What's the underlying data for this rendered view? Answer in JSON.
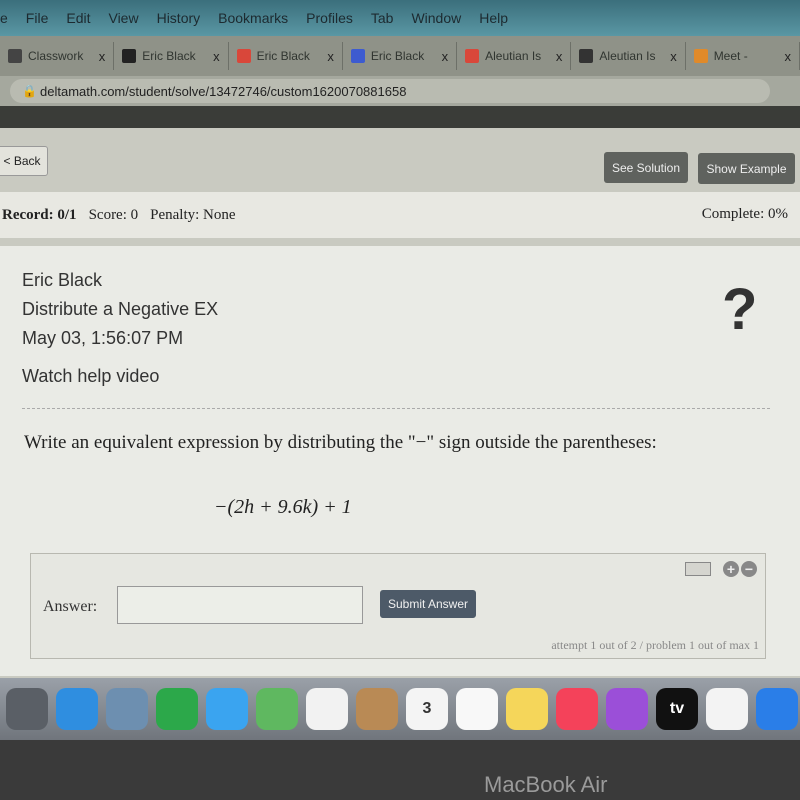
{
  "menubar": [
    "e",
    "File",
    "Edit",
    "View",
    "History",
    "Bookmarks",
    "Profiles",
    "Tab",
    "Window",
    "Help"
  ],
  "tabs": [
    {
      "label": "Classwork",
      "color": "#444"
    },
    {
      "label": "Eric Black",
      "color": "#222"
    },
    {
      "label": "Eric Black",
      "color": "#d9473a"
    },
    {
      "label": "Eric Black",
      "color": "#3d5bd0"
    },
    {
      "label": "Aleutian Is",
      "color": "#d9473a"
    },
    {
      "label": "Aleutian Is",
      "color": "#333"
    },
    {
      "label": "Meet -",
      "color": "#e08a2a"
    }
  ],
  "tab_close": "x",
  "url": "deltamath.com/student/solve/13472746/custom1620070881658",
  "toolbar": {
    "back": "< Back",
    "see_solution": "See Solution",
    "show_example": "Show Example"
  },
  "record": {
    "record": "Record: 0/1",
    "score": "Score: 0",
    "penalty": "Penalty: None",
    "complete": "Complete: 0%"
  },
  "info": {
    "name": "Eric Black",
    "assignment": "Distribute a Negative EX",
    "date": "May 03, 1:56:07 PM",
    "help": "Watch help video",
    "help_icon": "?"
  },
  "question": "Write an equivalent expression by distributing the \"−\" sign outside the parentheses:",
  "expression": "−(2h + 9.6k) + 1",
  "answer": {
    "label": "Answer:",
    "value": "",
    "submit": "Submit Answer",
    "attempt": "attempt 1 out of 2 / problem 1 out of max 1",
    "plus": "+",
    "minus": "−"
  },
  "dock": [
    {
      "name": "launchpad",
      "color": "#5a5f66"
    },
    {
      "name": "safari",
      "color": "#2f8ee0"
    },
    {
      "name": "preview",
      "color": "#6d8fb0"
    },
    {
      "name": "facetime",
      "color": "#2ca84a"
    },
    {
      "name": "messages",
      "color": "#3aa4f0"
    },
    {
      "name": "maps",
      "color": "#5fb860"
    },
    {
      "name": "photos",
      "color": "#f2f2f2"
    },
    {
      "name": "contacts",
      "color": "#b98a55"
    },
    {
      "name": "calendar",
      "color": "#f4f4f4",
      "text": "3"
    },
    {
      "name": "reminders",
      "color": "#f8f8f8"
    },
    {
      "name": "notes",
      "color": "#f5d65a"
    },
    {
      "name": "music",
      "color": "#f4425a"
    },
    {
      "name": "podcasts",
      "color": "#9b4fd8"
    },
    {
      "name": "tv",
      "color": "#111",
      "text": "tv"
    },
    {
      "name": "news",
      "color": "#f3f3f3"
    },
    {
      "name": "app-store",
      "color": "#2a7ee8"
    }
  ],
  "bezel": "MacBook Air"
}
